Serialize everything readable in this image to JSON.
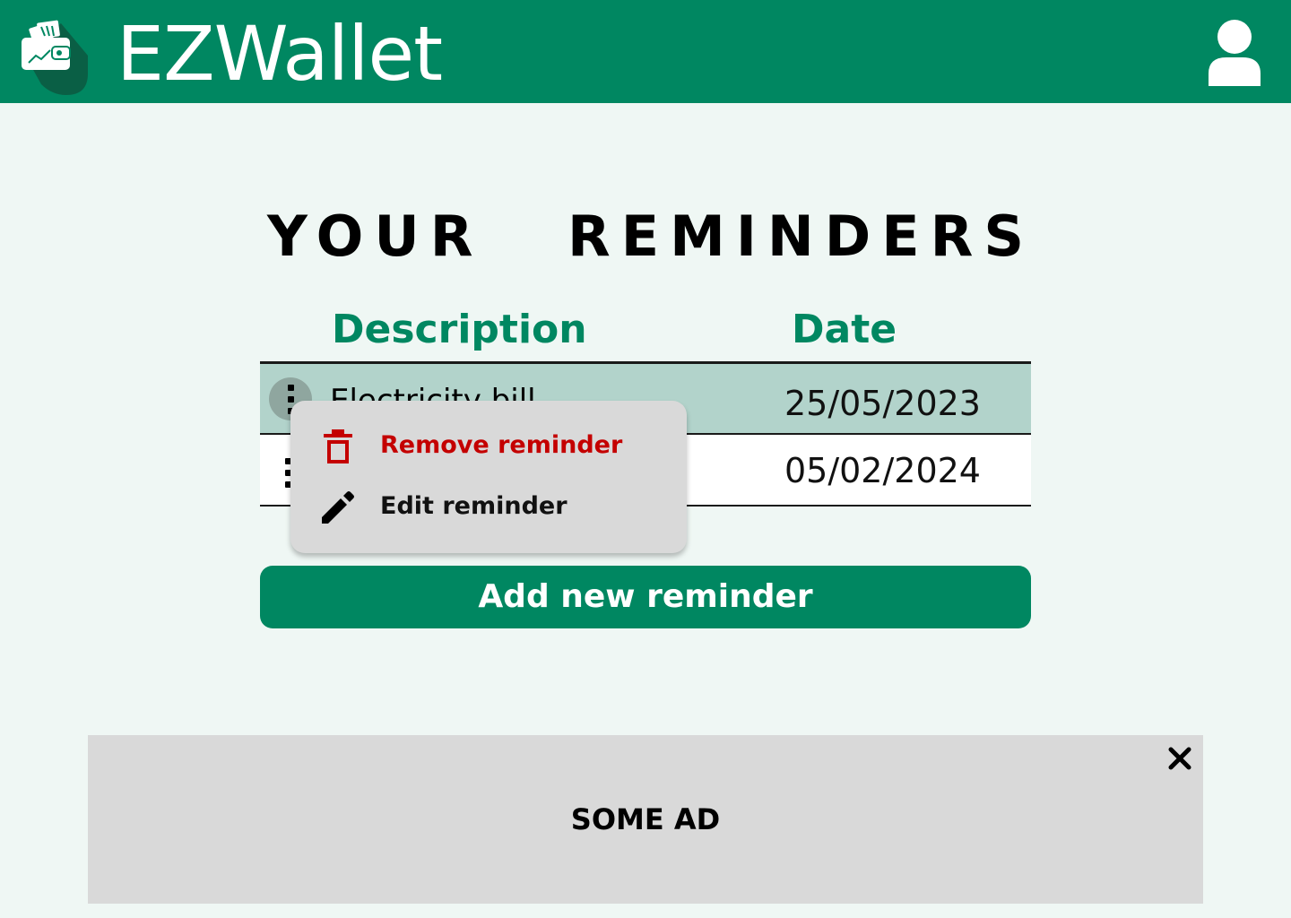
{
  "header": {
    "app_name": "EZWallet",
    "logo_icon": "wallet-logo-icon",
    "profile_icon": "user-profile-icon",
    "brand_color": "#008761"
  },
  "page": {
    "title": "YOUR REMINDERS"
  },
  "table": {
    "columns": [
      "Description",
      "Date"
    ],
    "rows": [
      {
        "description": "Electricity bill",
        "date": "25/05/2023",
        "highlighted": true
      },
      {
        "description": "",
        "date": "05/02/2024",
        "highlighted": false
      }
    ],
    "row_highlight_color": "#b2d3cb"
  },
  "context_menu": {
    "items": [
      {
        "label": "Remove reminder",
        "icon": "trash-icon",
        "color": "#c40000"
      },
      {
        "label": "Edit reminder",
        "icon": "pencil-icon",
        "color": "#111111"
      }
    ]
  },
  "actions": {
    "add_label": "Add new reminder"
  },
  "ad": {
    "text": "SOME AD",
    "close_icon": "close-icon"
  }
}
